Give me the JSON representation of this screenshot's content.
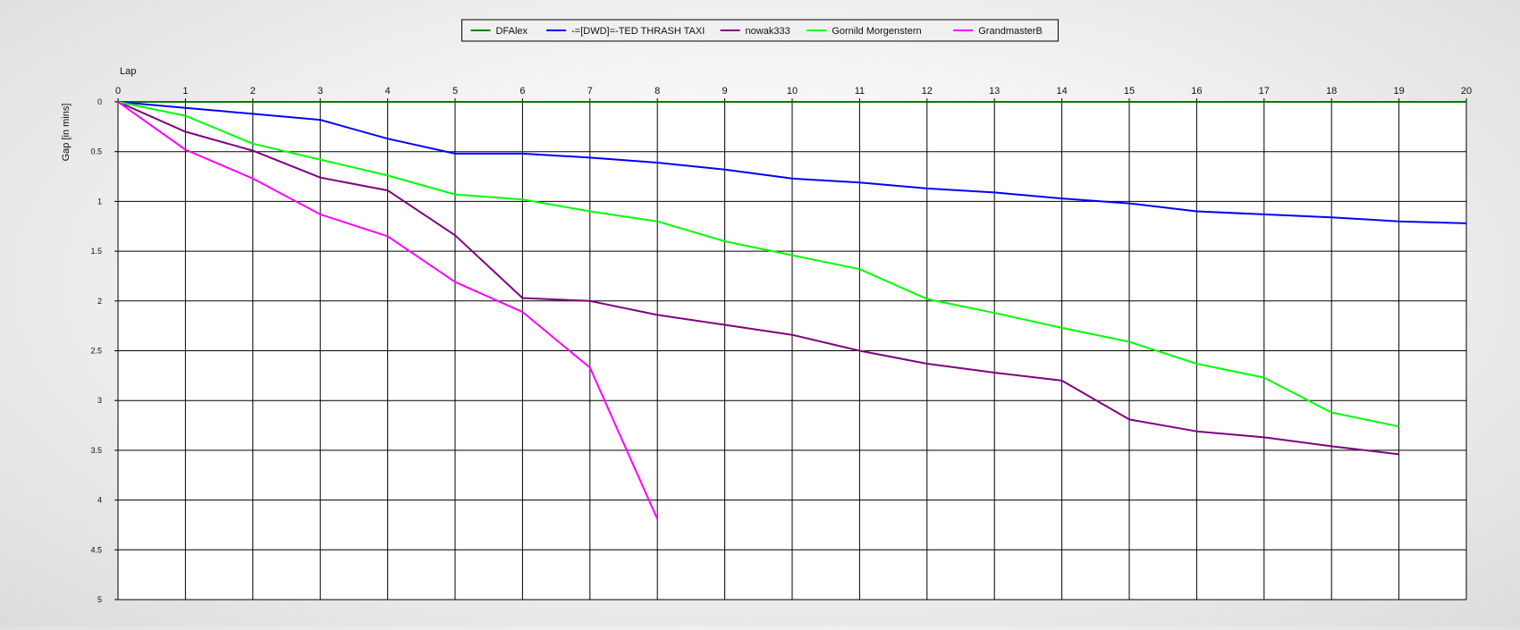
{
  "chart_data": {
    "type": "line",
    "xlabel": "Lap",
    "ylabel": "Gap [in mins]",
    "xlim": [
      0,
      20
    ],
    "ylim": [
      0,
      5
    ],
    "y_inverted": true,
    "grid": true,
    "legend_position": "top-center",
    "x_ticks": [
      "0",
      "1",
      "2",
      "3",
      "4",
      "5",
      "6",
      "7",
      "8",
      "9",
      "10",
      "11",
      "12",
      "13",
      "14",
      "15",
      "16",
      "17",
      "18",
      "19",
      "20"
    ],
    "y_ticks": [
      "0",
      "0.5",
      "1",
      "1.5",
      "2",
      "2.5",
      "3",
      "3.5",
      "4",
      "4.5",
      "5"
    ],
    "series": [
      {
        "name": "DFAlex",
        "color": "#008000",
        "x": [
          0,
          1,
          2,
          3,
          4,
          5,
          6,
          7,
          8,
          9,
          10,
          11,
          12,
          13,
          14,
          15,
          16,
          17,
          18,
          19,
          20
        ],
        "y": [
          0,
          0,
          0,
          0,
          0,
          0,
          0,
          0,
          0,
          0,
          0,
          0,
          0,
          0,
          0,
          0,
          0,
          0,
          0,
          0,
          0
        ]
      },
      {
        "name": "-=[DWD]=-TED THRASH TAXI",
        "color": "#0000ff",
        "x": [
          0,
          1,
          2,
          3,
          4,
          5,
          6,
          7,
          8,
          9,
          10,
          11,
          12,
          13,
          14,
          15,
          16,
          17,
          18,
          19,
          20
        ],
        "y": [
          0,
          0.06,
          0.12,
          0.18,
          0.37,
          0.52,
          0.52,
          0.56,
          0.61,
          0.68,
          0.77,
          0.81,
          0.87,
          0.91,
          0.97,
          1.02,
          1.1,
          1.13,
          1.16,
          1.2,
          1.22
        ]
      },
      {
        "name": "nowak333",
        "color": "#800080",
        "x": [
          0,
          1,
          2,
          3,
          4,
          5,
          6,
          7,
          8,
          9,
          10,
          11,
          12,
          13,
          14,
          15,
          16,
          17,
          18,
          19
        ],
        "y": [
          0,
          0.3,
          0.49,
          0.76,
          0.89,
          1.34,
          1.97,
          2.0,
          2.14,
          2.24,
          2.34,
          2.5,
          2.63,
          2.72,
          2.8,
          3.19,
          3.31,
          3.37,
          3.46,
          3.54
        ]
      },
      {
        "name": "Gornild Morgenstern",
        "color": "#00ff00",
        "x": [
          0,
          1,
          2,
          3,
          4,
          5,
          6,
          7,
          8,
          9,
          10,
          11,
          12,
          13,
          14,
          15,
          16,
          17,
          18,
          19
        ],
        "y": [
          0,
          0.14,
          0.42,
          0.58,
          0.74,
          0.93,
          0.98,
          1.1,
          1.2,
          1.4,
          1.54,
          1.68,
          1.98,
          2.12,
          2.27,
          2.41,
          2.63,
          2.77,
          3.12,
          3.26
        ]
      },
      {
        "name": "GrandmasterB",
        "color": "#ff00ff",
        "x": [
          0,
          1,
          2,
          3,
          4,
          5,
          6,
          7,
          8
        ],
        "y": [
          0,
          0.48,
          0.77,
          1.13,
          1.35,
          1.81,
          2.11,
          2.67,
          4.19
        ]
      }
    ]
  }
}
